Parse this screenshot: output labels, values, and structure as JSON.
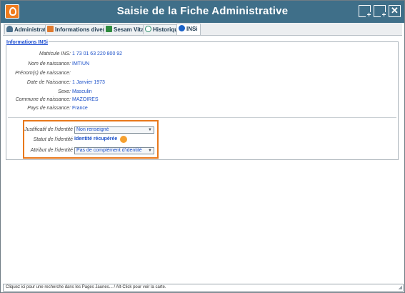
{
  "window": {
    "title": "Saisie de la Fiche Administrative"
  },
  "titlebar_buttons": {
    "new1": "+",
    "new2": "+",
    "close": "✕"
  },
  "tabs": [
    {
      "label": "Administratif",
      "icon": "person-icon",
      "color": "#4a6f8c"
    },
    {
      "label": "Informations diverses",
      "icon": "info-card-icon",
      "color": "#e07a2e"
    },
    {
      "label": "Sesam Vitale",
      "icon": "vitale-card-icon",
      "color": "#2e8b3e"
    },
    {
      "label": "Historique",
      "icon": "history-icon",
      "color": "#2c8d6a"
    },
    {
      "label": "INSi",
      "icon": "check-circle-icon",
      "color": "#1a62c8"
    }
  ],
  "section": {
    "title": "Informations INSi",
    "rows": [
      {
        "label": "Matricule INS:",
        "value": "1 73 01 63 220 800 92"
      },
      {
        "label": "Nom de naissance:",
        "value": "IMTIUN"
      },
      {
        "label": "Prénom(s) de naissance:",
        "value": ""
      },
      {
        "label": "Date de Naissance:",
        "value": "1 Janvier 1973"
      },
      {
        "label": "Sexe:",
        "value": "Masculin"
      },
      {
        "label": "Commune de naissance:",
        "value": "MAZOIRES"
      },
      {
        "label": "Pays de naissance:",
        "value": "France"
      }
    ]
  },
  "identity": {
    "justificatif_label": "Justificatif de l'identité",
    "justificatif_value": "Non renseigné",
    "statut_label": "Statut de l'identité",
    "statut_value": "Identité récupérée",
    "statut_color": "#f5a030",
    "attribut_label": "Attribut de l'identité",
    "attribut_value": "Pas de complément d'identité"
  },
  "statusbar": {
    "text": "Cliquez ici pour une recherche dans les Pages Jaunes... / Alt-Click pour voir la carte."
  },
  "colors": {
    "titlebar": "#3f6f89",
    "highlight": "#e8781b",
    "link": "#1a4fc8"
  }
}
